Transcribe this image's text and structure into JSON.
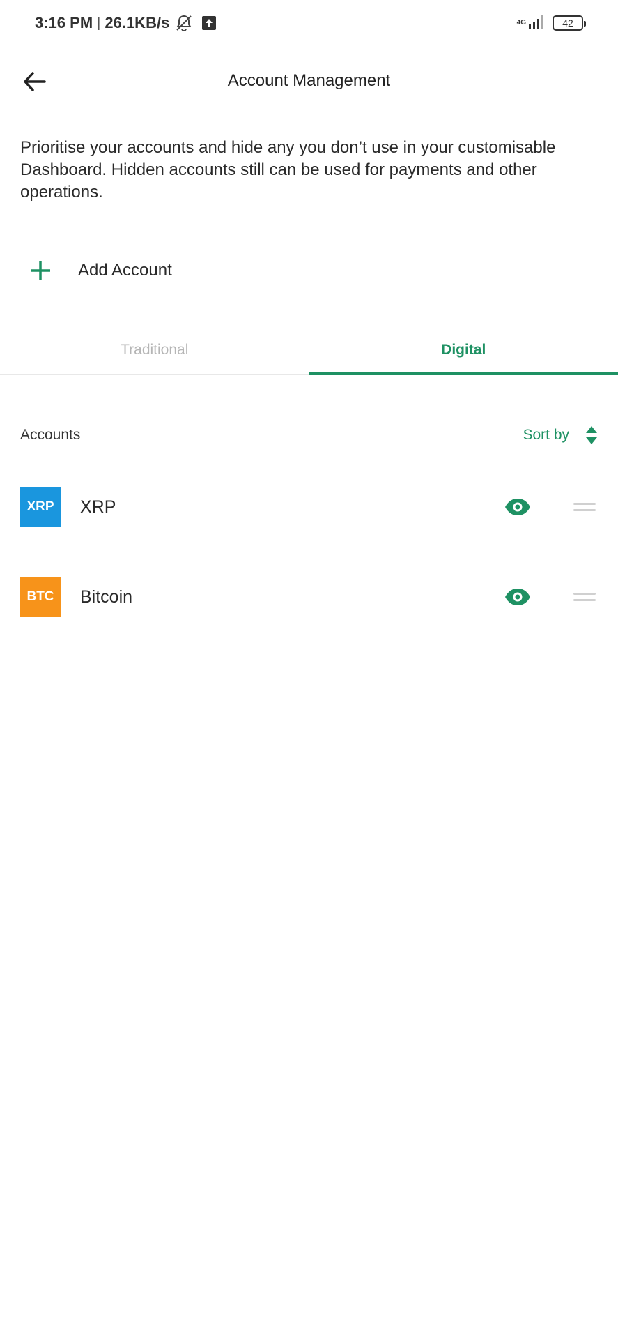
{
  "status_bar": {
    "time": "3:16 PM",
    "separator": "|",
    "speed": "26.1KB/s",
    "network": "4G",
    "battery": "42"
  },
  "header": {
    "title": "Account Management"
  },
  "description": "Prioritise your accounts and hide any you don’t use in your customisable Dashboard. Hidden accounts still can be used for payments and other operations.",
  "add_account": {
    "label": "Add Account"
  },
  "tabs": [
    {
      "label": "Traditional",
      "active": false
    },
    {
      "label": "Digital",
      "active": true
    }
  ],
  "accounts_section": {
    "label": "Accounts",
    "sort_label": "Sort by"
  },
  "accounts": [
    {
      "code": "XRP",
      "name": "XRP",
      "logo_color": "#1a96de",
      "visible": true
    },
    {
      "code": "BTC",
      "name": "Bitcoin",
      "logo_color": "#f7931a",
      "visible": true
    }
  ],
  "colors": {
    "accent": "#1e9163",
    "inactive_tab": "#b5b5b5",
    "handle": "#d0d0d0"
  }
}
